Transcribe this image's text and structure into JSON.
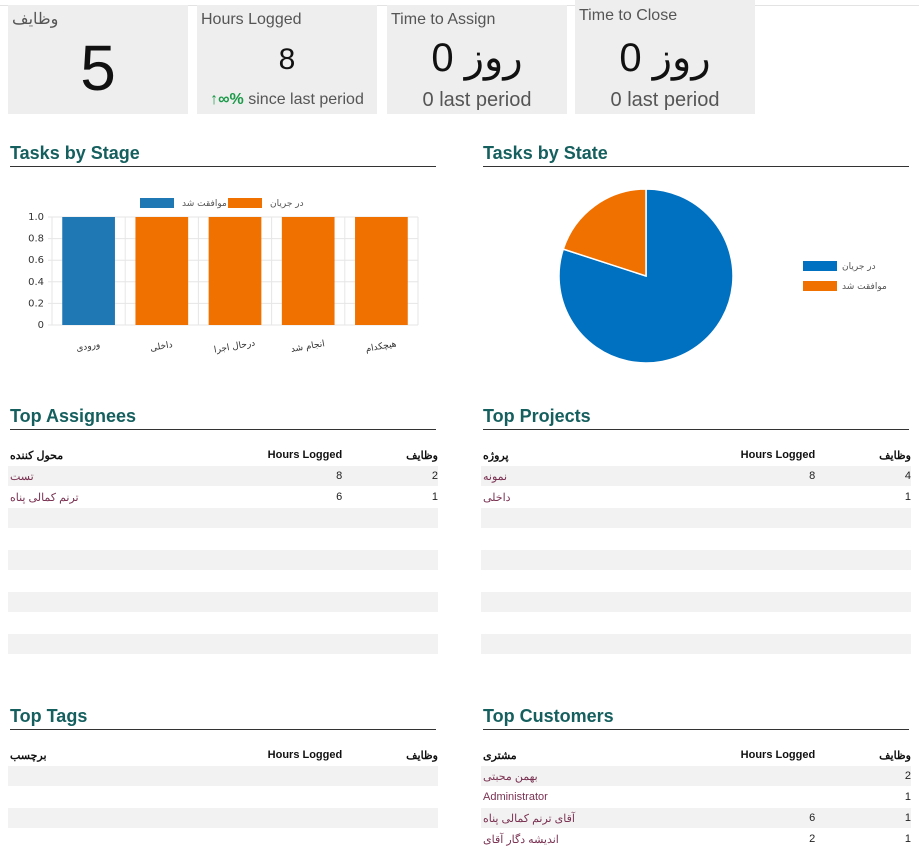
{
  "kpis": {
    "tasks": {
      "label": "وظایف",
      "value": "5"
    },
    "hours": {
      "label": "Hours Logged",
      "value": "8",
      "trend_arrow": "↑",
      "trend_pct": "∞%",
      "trend_text": "since last period"
    },
    "assign": {
      "label": "Time to Assign",
      "value": "0 روز",
      "sub": "0 last period"
    },
    "close": {
      "label": "Time to Close",
      "value": "0 روز",
      "sub": "0 last period"
    }
  },
  "sections": {
    "by_stage": "Tasks by Stage",
    "by_state": "Tasks by State",
    "assignees": "Top Assignees",
    "projects": "Top Projects",
    "tags": "Top Tags",
    "customers": "Top Customers"
  },
  "colors": {
    "blue": "#1f77b4",
    "orange": "#f07000",
    "pie_blue": "#0070c0",
    "pie_orange": "#f07000"
  },
  "chart_data": [
    {
      "type": "bar",
      "title": "Tasks by Stage",
      "categories": [
        "ورودی",
        "داخلی",
        "درحال اجرا",
        "انجام شد",
        "هیچکدام"
      ],
      "series": [
        {
          "name": "موافقت شد",
          "values": [
            1,
            0,
            0,
            0,
            0
          ]
        },
        {
          "name": "در جریان",
          "values": [
            0,
            1,
            1,
            1,
            1
          ]
        }
      ],
      "ylim": [
        0,
        1.0
      ],
      "yticks": [
        "1.0",
        "0.8",
        "0.6",
        "0.4",
        "0.2",
        "0"
      ],
      "legend": "top"
    },
    {
      "type": "pie",
      "title": "Tasks by State",
      "labels": [
        "در جریان",
        "موافقت شد"
      ],
      "values": [
        4,
        1
      ],
      "legend": "right"
    }
  ],
  "assignees": {
    "headers": {
      "c1": "محول کننده",
      "c2": "Hours Logged",
      "c3": "وظایف"
    },
    "rows": [
      {
        "c1": "تست",
        "c2": "8",
        "c3": "2"
      },
      {
        "c1": "ترنم کمالی پناه",
        "c2": "6",
        "c3": "1"
      }
    ]
  },
  "projects": {
    "headers": {
      "c1": "پروژه",
      "c2": "Hours Logged",
      "c3": "وظایف"
    },
    "rows": [
      {
        "c1": "نمونه",
        "c2": "8",
        "c3": "4"
      },
      {
        "c1": "داخلی",
        "c2": "",
        "c3": "1"
      }
    ]
  },
  "tags": {
    "headers": {
      "c1": "برچسب",
      "c2": "Hours Logged",
      "c3": "وظایف"
    }
  },
  "customers": {
    "headers": {
      "c1": "مشتری",
      "c2": "Hours Logged",
      "c3": "وظایف"
    },
    "rows": [
      {
        "c1": "بهمن محبتی",
        "c2": "",
        "c3": "2"
      },
      {
        "c1": "Administrator",
        "c2": "",
        "c3": "1"
      },
      {
        "c1": "آقای ترنم کمالی پناه",
        "c2": "6",
        "c3": "1"
      },
      {
        "c1": "اندیشه دگار آقای",
        "c2": "2",
        "c3": "1"
      }
    ]
  }
}
